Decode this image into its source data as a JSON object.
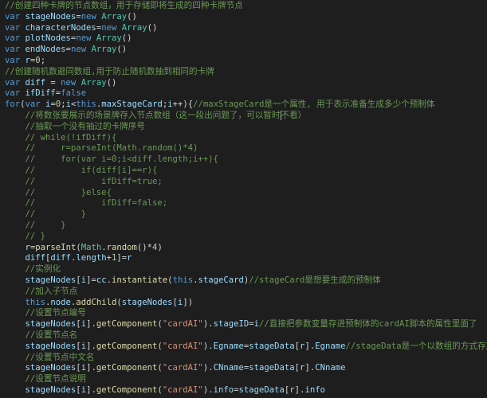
{
  "theme": {
    "background": "#1e1e1e",
    "keyword": "#569cd6",
    "variable": "#9cdcfe",
    "function": "#dcdcaa",
    "class": "#4ec9b0",
    "number": "#b5cea8",
    "string": "#ce9178",
    "comment": "#6a9955",
    "plain": "#d4d4d4"
  },
  "lines": [
    [
      [
        "cm",
        "//创建四种卡牌的节点数组，用于存储即将生成的四种卡牌节点"
      ]
    ],
    [
      [
        "kw",
        "var "
      ],
      [
        "id",
        "stageNodes"
      ],
      [
        "pl",
        "="
      ],
      [
        "kw",
        "new "
      ],
      [
        "cls",
        "Array"
      ],
      [
        "pl",
        "()"
      ]
    ],
    [
      [
        "kw",
        "var "
      ],
      [
        "id",
        "characterNodes"
      ],
      [
        "pl",
        "="
      ],
      [
        "kw",
        "new "
      ],
      [
        "cls",
        "Array"
      ],
      [
        "pl",
        "()"
      ]
    ],
    [
      [
        "kw",
        "var "
      ],
      [
        "id",
        "plotNodes"
      ],
      [
        "pl",
        "="
      ],
      [
        "kw",
        "new "
      ],
      [
        "cls",
        "Array"
      ],
      [
        "pl",
        "()"
      ]
    ],
    [
      [
        "kw",
        "var "
      ],
      [
        "id",
        "endNodes"
      ],
      [
        "pl",
        "="
      ],
      [
        "kw",
        "new "
      ],
      [
        "cls",
        "Array"
      ],
      [
        "pl",
        "()"
      ]
    ],
    [
      [
        "kw",
        "var "
      ],
      [
        "id",
        "r"
      ],
      [
        "pl",
        "="
      ],
      [
        "num",
        "0"
      ],
      [
        "pl",
        ";"
      ]
    ],
    [
      [
        "cm",
        "//创建随机数避同数组,用于防止随机数抽到相同的卡牌"
      ]
    ],
    [
      [
        "kw",
        "var "
      ],
      [
        "id",
        "diff"
      ],
      [
        "pl",
        " = "
      ],
      [
        "kw",
        "new "
      ],
      [
        "cls",
        "Array"
      ],
      [
        "pl",
        "()"
      ]
    ],
    [
      [
        "kw",
        "var "
      ],
      [
        "id",
        "ifDiff"
      ],
      [
        "pl",
        "="
      ],
      [
        "kw",
        "false"
      ]
    ],
    [
      [
        "kw",
        "for"
      ],
      [
        "pl",
        "("
      ],
      [
        "kw",
        "var "
      ],
      [
        "id",
        "i"
      ],
      [
        "pl",
        "="
      ],
      [
        "num",
        "0"
      ],
      [
        "pl",
        ";"
      ],
      [
        "id",
        "i"
      ],
      [
        "pl",
        "<"
      ],
      [
        "kw",
        "this"
      ],
      [
        "pl",
        "."
      ],
      [
        "id",
        "maxStageCard"
      ],
      [
        "pl",
        ";"
      ],
      [
        "id",
        "i"
      ],
      [
        "pl",
        "++){"
      ],
      [
        "cm",
        "//maxStageCard是一个属性, 用于表示准备生成多少个预制体"
      ]
    ],
    [
      [
        "pl",
        "    "
      ],
      [
        "cm",
        "//将数张要展示的场景牌存入节点数组（这一段出问题了，可以暂时"
      ],
      [
        "cursor",
        ""
      ],
      [
        "cm",
        "不看）"
      ]
    ],
    [
      [
        "pl",
        "    "
      ],
      [
        "cm",
        "//抽取一个没有抽过的卡牌序号"
      ]
    ],
    [
      [
        "pl",
        "    "
      ],
      [
        "cm",
        "// while(!ifDiff){"
      ]
    ],
    [
      [
        "pl",
        "    "
      ],
      [
        "cm",
        "//     r=parseInt(Math.random()*4)"
      ]
    ],
    [
      [
        "pl",
        "    "
      ],
      [
        "cm",
        "//     for(var i=0;i<diff.length;i++){"
      ]
    ],
    [
      [
        "pl",
        "    "
      ],
      [
        "cm",
        "//         if(diff[i]==r){"
      ]
    ],
    [
      [
        "pl",
        "    "
      ],
      [
        "cm",
        "//             ifDiff=true;"
      ]
    ],
    [
      [
        "pl",
        "    "
      ],
      [
        "cm",
        "//         }else{"
      ]
    ],
    [
      [
        "pl",
        "    "
      ],
      [
        "cm",
        "//             ifDiff=false;"
      ]
    ],
    [
      [
        "pl",
        "    "
      ],
      [
        "cm",
        "//         }"
      ]
    ],
    [
      [
        "pl",
        "    "
      ],
      [
        "cm",
        "//     }"
      ]
    ],
    [
      [
        "pl",
        "    "
      ],
      [
        "cm",
        "// }"
      ]
    ],
    [
      [
        "pl",
        "    "
      ],
      [
        "id",
        "r"
      ],
      [
        "pl",
        "="
      ],
      [
        "fn",
        "parseInt"
      ],
      [
        "pl",
        "("
      ],
      [
        "cls",
        "Math"
      ],
      [
        "pl",
        "."
      ],
      [
        "fn",
        "random"
      ],
      [
        "pl",
        "()*"
      ],
      [
        "num",
        "4"
      ],
      [
        "pl",
        ")"
      ]
    ],
    [
      [
        "pl",
        "    "
      ],
      [
        "id",
        "diff"
      ],
      [
        "pl",
        "["
      ],
      [
        "id",
        "diff"
      ],
      [
        "pl",
        "."
      ],
      [
        "id",
        "length"
      ],
      [
        "pl",
        "+"
      ],
      [
        "num",
        "1"
      ],
      [
        "pl",
        "]="
      ],
      [
        "id",
        "r"
      ]
    ],
    [
      [
        "pl",
        "    "
      ],
      [
        "cm",
        "//实例化"
      ]
    ],
    [
      [
        "pl",
        "    "
      ],
      [
        "id",
        "stageNodes"
      ],
      [
        "pl",
        "["
      ],
      [
        "id",
        "i"
      ],
      [
        "pl",
        "]="
      ],
      [
        "id",
        "cc"
      ],
      [
        "pl",
        "."
      ],
      [
        "fn",
        "instantiate"
      ],
      [
        "pl",
        "("
      ],
      [
        "kw",
        "this"
      ],
      [
        "pl",
        "."
      ],
      [
        "id",
        "stageCard"
      ],
      [
        "pl",
        ")"
      ],
      [
        "cm",
        "//stageCard是想要生成的预制体"
      ]
    ],
    [
      [
        "pl",
        "    "
      ],
      [
        "cm",
        "//加入子节点"
      ]
    ],
    [
      [
        "pl",
        "    "
      ],
      [
        "kw",
        "this"
      ],
      [
        "pl",
        "."
      ],
      [
        "id",
        "node"
      ],
      [
        "pl",
        "."
      ],
      [
        "fn",
        "addChild"
      ],
      [
        "pl",
        "("
      ],
      [
        "id",
        "stageNodes"
      ],
      [
        "pl",
        "["
      ],
      [
        "id",
        "i"
      ],
      [
        "pl",
        "])"
      ]
    ],
    [
      [
        "pl",
        "    "
      ],
      [
        "cm",
        "//设置节点编号"
      ]
    ],
    [
      [
        "pl",
        "    "
      ],
      [
        "id",
        "stageNodes"
      ],
      [
        "pl",
        "["
      ],
      [
        "id",
        "i"
      ],
      [
        "pl",
        "]."
      ],
      [
        "fn",
        "getComponent"
      ],
      [
        "pl",
        "("
      ],
      [
        "str",
        "\"cardAI\""
      ],
      [
        "pl",
        ")."
      ],
      [
        "id",
        "stageID"
      ],
      [
        "pl",
        "="
      ],
      [
        "id",
        "i"
      ],
      [
        "cm",
        "//直接把参数变量存进预制体的cardAI脚本的属性里面了"
      ]
    ],
    [
      [
        "pl",
        "    "
      ],
      [
        "cm",
        "//设置节点名"
      ]
    ],
    [
      [
        "pl",
        "    "
      ],
      [
        "id",
        "stageNodes"
      ],
      [
        "pl",
        "["
      ],
      [
        "id",
        "i"
      ],
      [
        "pl",
        "]."
      ],
      [
        "fn",
        "getComponent"
      ],
      [
        "pl",
        "("
      ],
      [
        "str",
        "\"cardAI\""
      ],
      [
        "pl",
        ")."
      ],
      [
        "id",
        "Egname"
      ],
      [
        "pl",
        "="
      ],
      [
        "id",
        "stageData"
      ],
      [
        "pl",
        "["
      ],
      [
        "id",
        "r"
      ],
      [
        "pl",
        "]."
      ],
      [
        "id",
        "Egname"
      ],
      [
        "cm",
        "//stageData是一个以数组的方式存放的json数据"
      ]
    ],
    [
      [
        "pl",
        "    "
      ],
      [
        "cm",
        "//设置节点中文名"
      ]
    ],
    [
      [
        "pl",
        "    "
      ],
      [
        "id",
        "stageNodes"
      ],
      [
        "pl",
        "["
      ],
      [
        "id",
        "i"
      ],
      [
        "pl",
        "]."
      ],
      [
        "fn",
        "getComponent"
      ],
      [
        "pl",
        "("
      ],
      [
        "str",
        "\"cardAI\""
      ],
      [
        "pl",
        ")."
      ],
      [
        "id",
        "CNname"
      ],
      [
        "pl",
        "="
      ],
      [
        "id",
        "stageData"
      ],
      [
        "pl",
        "["
      ],
      [
        "id",
        "r"
      ],
      [
        "pl",
        "]."
      ],
      [
        "id",
        "CNname"
      ]
    ],
    [
      [
        "pl",
        "    "
      ],
      [
        "cm",
        "//设置节点说明"
      ]
    ],
    [
      [
        "pl",
        "    "
      ],
      [
        "id",
        "stageNodes"
      ],
      [
        "pl",
        "["
      ],
      [
        "id",
        "i"
      ],
      [
        "pl",
        "]."
      ],
      [
        "fn",
        "getComponent"
      ],
      [
        "pl",
        "("
      ],
      [
        "str",
        "\"cardAI\""
      ],
      [
        "pl",
        ")."
      ],
      [
        "id",
        "info"
      ],
      [
        "pl",
        "="
      ],
      [
        "id",
        "stageData"
      ],
      [
        "pl",
        "["
      ],
      [
        "id",
        "r"
      ],
      [
        "pl",
        "]."
      ],
      [
        "id",
        "info"
      ]
    ]
  ]
}
